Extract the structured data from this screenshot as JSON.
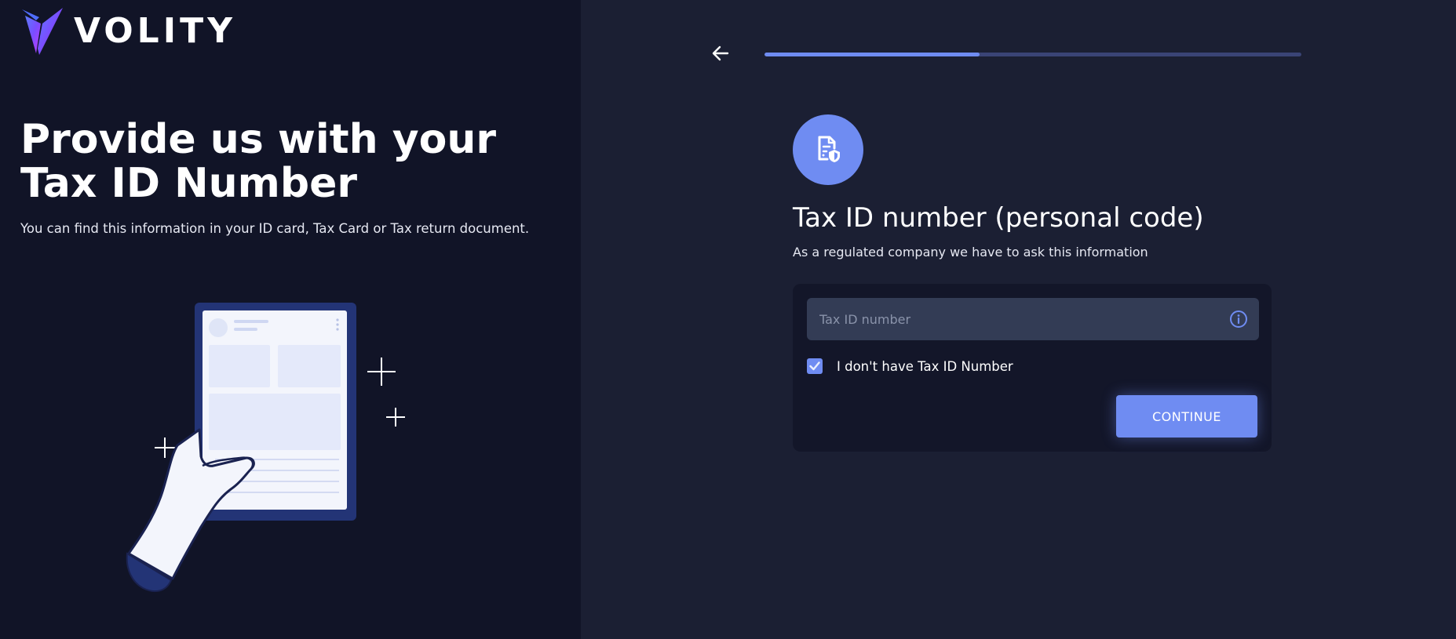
{
  "brand": {
    "name": "VOLITY"
  },
  "left_panel": {
    "headline_line1": "Provide us with your",
    "headline_line2": "Tax ID Number",
    "subtext": "You can find this information in your ID card, Tax Card or Tax return document."
  },
  "progress": {
    "fraction": 0.4
  },
  "icons": {
    "back": "arrow-left-icon",
    "document": "document-shield-icon",
    "info": "info-icon",
    "check": "check-icon"
  },
  "form": {
    "title": "Tax ID number (personal code)",
    "subtitle": "As a regulated company we have to ask this information",
    "tax_id": {
      "placeholder": "Tax ID number",
      "value": ""
    },
    "no_tax_id": {
      "label": "I don't have Tax ID Number",
      "checked": true
    },
    "continue_label": "CONTINUE"
  },
  "colors": {
    "accent": "#6f8cf2",
    "left_bg": "#111427",
    "right_bg": "#1b1f33",
    "card_bg": "#131629",
    "input_bg": "#333c55"
  }
}
